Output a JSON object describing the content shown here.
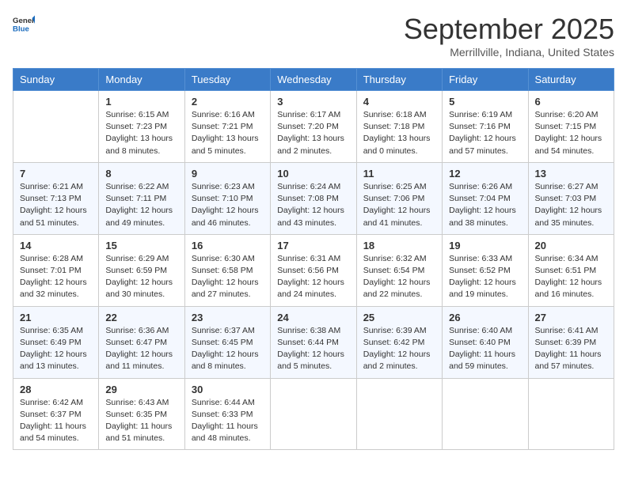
{
  "logo": {
    "general": "General",
    "blue": "Blue"
  },
  "header": {
    "month": "September 2025",
    "location": "Merrillville, Indiana, United States"
  },
  "days": [
    "Sunday",
    "Monday",
    "Tuesday",
    "Wednesday",
    "Thursday",
    "Friday",
    "Saturday"
  ],
  "weeks": [
    [
      {
        "num": "",
        "sunrise": "",
        "sunset": "",
        "daylight": ""
      },
      {
        "num": "1",
        "sunrise": "Sunrise: 6:15 AM",
        "sunset": "Sunset: 7:23 PM",
        "daylight": "Daylight: 13 hours and 8 minutes."
      },
      {
        "num": "2",
        "sunrise": "Sunrise: 6:16 AM",
        "sunset": "Sunset: 7:21 PM",
        "daylight": "Daylight: 13 hours and 5 minutes."
      },
      {
        "num": "3",
        "sunrise": "Sunrise: 6:17 AM",
        "sunset": "Sunset: 7:20 PM",
        "daylight": "Daylight: 13 hours and 2 minutes."
      },
      {
        "num": "4",
        "sunrise": "Sunrise: 6:18 AM",
        "sunset": "Sunset: 7:18 PM",
        "daylight": "Daylight: 13 hours and 0 minutes."
      },
      {
        "num": "5",
        "sunrise": "Sunrise: 6:19 AM",
        "sunset": "Sunset: 7:16 PM",
        "daylight": "Daylight: 12 hours and 57 minutes."
      },
      {
        "num": "6",
        "sunrise": "Sunrise: 6:20 AM",
        "sunset": "Sunset: 7:15 PM",
        "daylight": "Daylight: 12 hours and 54 minutes."
      }
    ],
    [
      {
        "num": "7",
        "sunrise": "Sunrise: 6:21 AM",
        "sunset": "Sunset: 7:13 PM",
        "daylight": "Daylight: 12 hours and 51 minutes."
      },
      {
        "num": "8",
        "sunrise": "Sunrise: 6:22 AM",
        "sunset": "Sunset: 7:11 PM",
        "daylight": "Daylight: 12 hours and 49 minutes."
      },
      {
        "num": "9",
        "sunrise": "Sunrise: 6:23 AM",
        "sunset": "Sunset: 7:10 PM",
        "daylight": "Daylight: 12 hours and 46 minutes."
      },
      {
        "num": "10",
        "sunrise": "Sunrise: 6:24 AM",
        "sunset": "Sunset: 7:08 PM",
        "daylight": "Daylight: 12 hours and 43 minutes."
      },
      {
        "num": "11",
        "sunrise": "Sunrise: 6:25 AM",
        "sunset": "Sunset: 7:06 PM",
        "daylight": "Daylight: 12 hours and 41 minutes."
      },
      {
        "num": "12",
        "sunrise": "Sunrise: 6:26 AM",
        "sunset": "Sunset: 7:04 PM",
        "daylight": "Daylight: 12 hours and 38 minutes."
      },
      {
        "num": "13",
        "sunrise": "Sunrise: 6:27 AM",
        "sunset": "Sunset: 7:03 PM",
        "daylight": "Daylight: 12 hours and 35 minutes."
      }
    ],
    [
      {
        "num": "14",
        "sunrise": "Sunrise: 6:28 AM",
        "sunset": "Sunset: 7:01 PM",
        "daylight": "Daylight: 12 hours and 32 minutes."
      },
      {
        "num": "15",
        "sunrise": "Sunrise: 6:29 AM",
        "sunset": "Sunset: 6:59 PM",
        "daylight": "Daylight: 12 hours and 30 minutes."
      },
      {
        "num": "16",
        "sunrise": "Sunrise: 6:30 AM",
        "sunset": "Sunset: 6:58 PM",
        "daylight": "Daylight: 12 hours and 27 minutes."
      },
      {
        "num": "17",
        "sunrise": "Sunrise: 6:31 AM",
        "sunset": "Sunset: 6:56 PM",
        "daylight": "Daylight: 12 hours and 24 minutes."
      },
      {
        "num": "18",
        "sunrise": "Sunrise: 6:32 AM",
        "sunset": "Sunset: 6:54 PM",
        "daylight": "Daylight: 12 hours and 22 minutes."
      },
      {
        "num": "19",
        "sunrise": "Sunrise: 6:33 AM",
        "sunset": "Sunset: 6:52 PM",
        "daylight": "Daylight: 12 hours and 19 minutes."
      },
      {
        "num": "20",
        "sunrise": "Sunrise: 6:34 AM",
        "sunset": "Sunset: 6:51 PM",
        "daylight": "Daylight: 12 hours and 16 minutes."
      }
    ],
    [
      {
        "num": "21",
        "sunrise": "Sunrise: 6:35 AM",
        "sunset": "Sunset: 6:49 PM",
        "daylight": "Daylight: 12 hours and 13 minutes."
      },
      {
        "num": "22",
        "sunrise": "Sunrise: 6:36 AM",
        "sunset": "Sunset: 6:47 PM",
        "daylight": "Daylight: 12 hours and 11 minutes."
      },
      {
        "num": "23",
        "sunrise": "Sunrise: 6:37 AM",
        "sunset": "Sunset: 6:45 PM",
        "daylight": "Daylight: 12 hours and 8 minutes."
      },
      {
        "num": "24",
        "sunrise": "Sunrise: 6:38 AM",
        "sunset": "Sunset: 6:44 PM",
        "daylight": "Daylight: 12 hours and 5 minutes."
      },
      {
        "num": "25",
        "sunrise": "Sunrise: 6:39 AM",
        "sunset": "Sunset: 6:42 PM",
        "daylight": "Daylight: 12 hours and 2 minutes."
      },
      {
        "num": "26",
        "sunrise": "Sunrise: 6:40 AM",
        "sunset": "Sunset: 6:40 PM",
        "daylight": "Daylight: 11 hours and 59 minutes."
      },
      {
        "num": "27",
        "sunrise": "Sunrise: 6:41 AM",
        "sunset": "Sunset: 6:39 PM",
        "daylight": "Daylight: 11 hours and 57 minutes."
      }
    ],
    [
      {
        "num": "28",
        "sunrise": "Sunrise: 6:42 AM",
        "sunset": "Sunset: 6:37 PM",
        "daylight": "Daylight: 11 hours and 54 minutes."
      },
      {
        "num": "29",
        "sunrise": "Sunrise: 6:43 AM",
        "sunset": "Sunset: 6:35 PM",
        "daylight": "Daylight: 11 hours and 51 minutes."
      },
      {
        "num": "30",
        "sunrise": "Sunrise: 6:44 AM",
        "sunset": "Sunset: 6:33 PM",
        "daylight": "Daylight: 11 hours and 48 minutes."
      },
      {
        "num": "",
        "sunrise": "",
        "sunset": "",
        "daylight": ""
      },
      {
        "num": "",
        "sunrise": "",
        "sunset": "",
        "daylight": ""
      },
      {
        "num": "",
        "sunrise": "",
        "sunset": "",
        "daylight": ""
      },
      {
        "num": "",
        "sunrise": "",
        "sunset": "",
        "daylight": ""
      }
    ]
  ]
}
